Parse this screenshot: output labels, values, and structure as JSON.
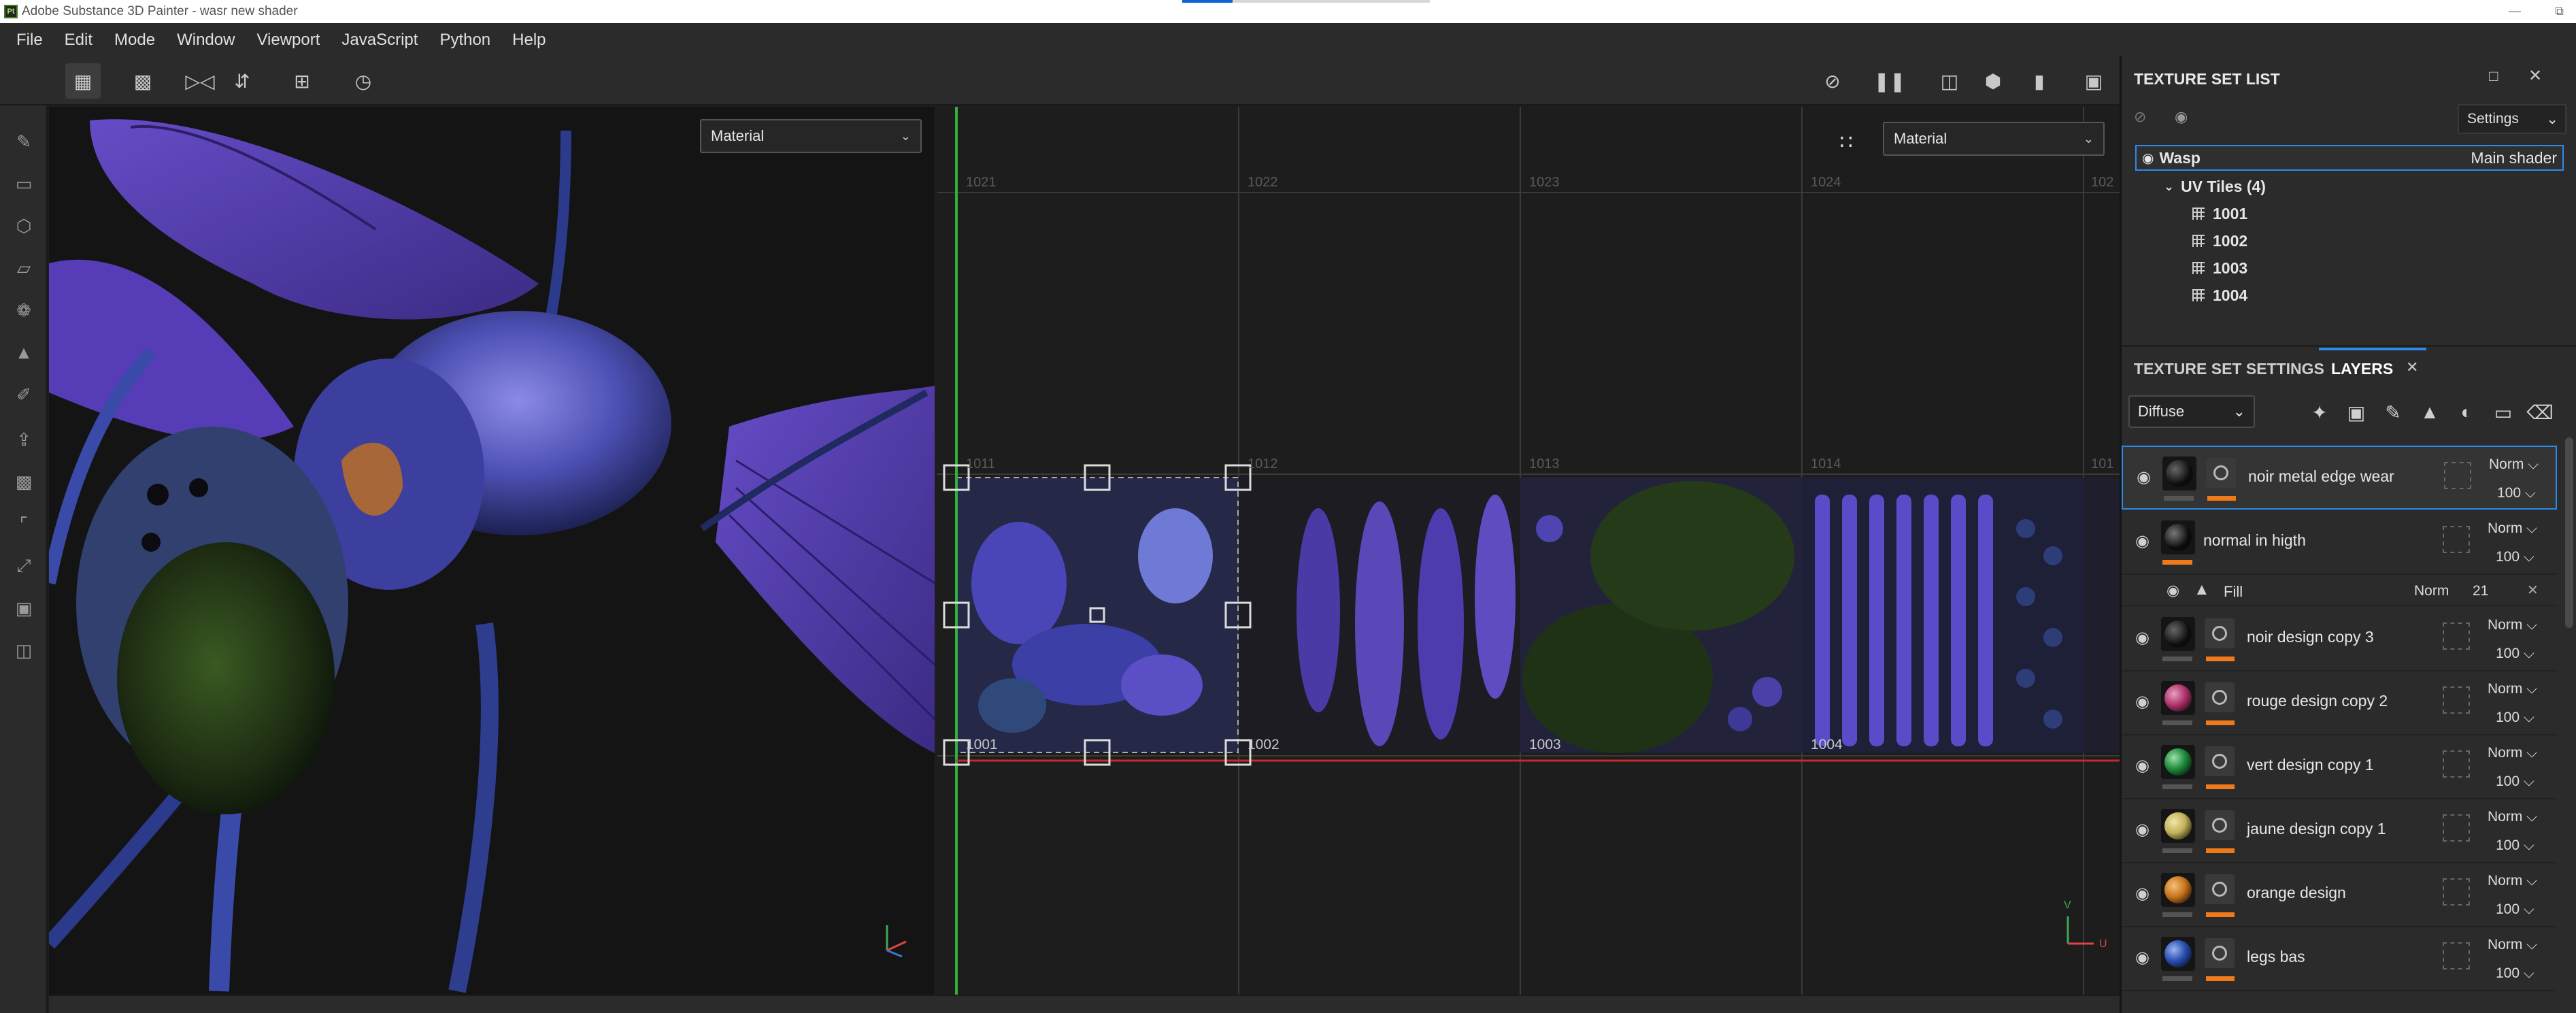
{
  "window": {
    "title": "Adobe Substance 3D Painter - wasr new shader",
    "logo_text": "Pt"
  },
  "menu": [
    "File",
    "Edit",
    "Mode",
    "Window",
    "Viewport",
    "JavaScript",
    "Python",
    "Help"
  ],
  "viewport3d": {
    "channel_select": "Material"
  },
  "viewport2d": {
    "channel_select": "Material",
    "top_tile_labels": [
      "1021",
      "1022",
      "1023",
      "1024",
      "102"
    ],
    "mid_tile_labels": [
      "1011",
      "1012",
      "1013",
      "1014",
      "101"
    ],
    "bottom_tile_labels": [
      "1001",
      "1002",
      "1003",
      "1004"
    ],
    "axis_v": "V",
    "axis_u": "U"
  },
  "texture_set_list": {
    "title": "TEXTURE SET LIST",
    "settings_label": "Settings",
    "set_name": "Wasp",
    "shader": "Main shader",
    "uv_group": "UV Tiles (4)",
    "tiles": [
      "1001",
      "1002",
      "1003",
      "1004"
    ]
  },
  "tabs": {
    "texture_set_settings": "TEXTURE SET SETTINGS",
    "layers": "LAYERS"
  },
  "layers_panel": {
    "channel_select": "Diffuse",
    "layers": [
      {
        "name": "noir metal edge wear",
        "blend": "Norm",
        "opacity": "100",
        "color": "#0c0c0c"
      },
      {
        "name": "normal in higth",
        "blend": "Norm",
        "opacity": "100",
        "color": "#0a0a0a"
      },
      {
        "name": "noir design copy 3",
        "blend": "Norm",
        "opacity": "100",
        "color": "#0c0c0c"
      },
      {
        "name": "rouge design copy 2",
        "blend": "Norm",
        "opacity": "100",
        "color": "#b0336a"
      },
      {
        "name": "vert design copy 1",
        "blend": "Norm",
        "opacity": "100",
        "color": "#1f8a3c"
      },
      {
        "name": "jaune design copy 1",
        "blend": "Norm",
        "opacity": "100",
        "color": "#c2b25a"
      },
      {
        "name": "orange design",
        "blend": "Norm",
        "opacity": "100",
        "color": "#c8741c"
      },
      {
        "name": "legs bas",
        "blend": "Norm",
        "opacity": "100",
        "color": "#2a4fb0"
      }
    ],
    "fill_effect": {
      "name": "Fill",
      "blend": "Norm",
      "opacity": "21"
    }
  }
}
